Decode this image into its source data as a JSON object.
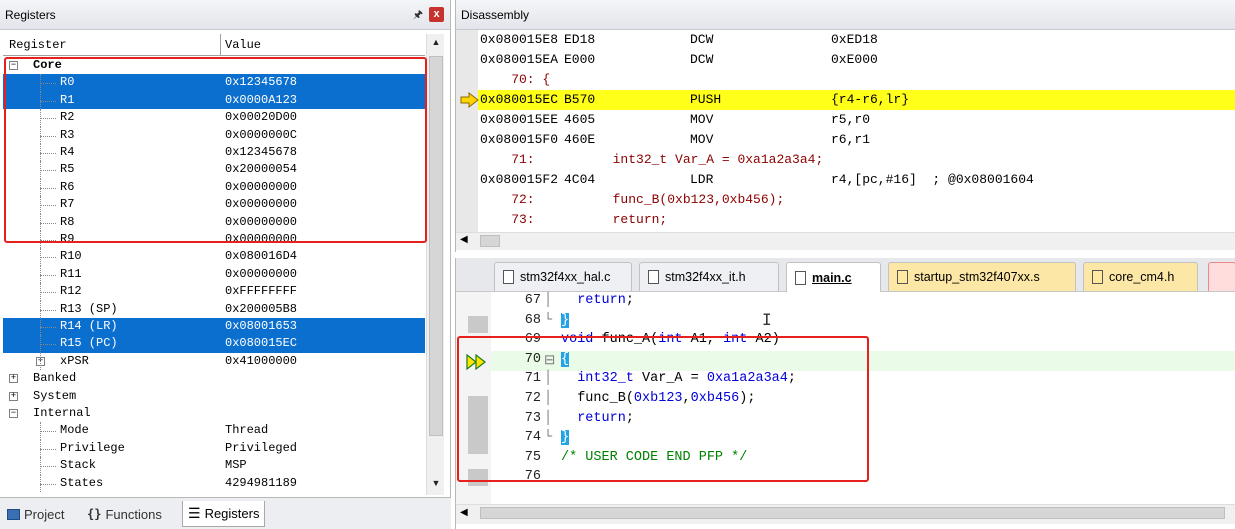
{
  "registers": {
    "title": "Registers",
    "col_register": "Register",
    "col_value": "Value",
    "rows": [
      {
        "name": "Core",
        "value": "",
        "level": 0,
        "expander": "−",
        "selected": false,
        "bold": true
      },
      {
        "name": "R0",
        "value": "0x12345678",
        "level": 1,
        "selected": true
      },
      {
        "name": "R1",
        "value": "0x0000A123",
        "level": 1,
        "selected": true
      },
      {
        "name": "R2",
        "value": "0x00020D00",
        "level": 1,
        "selected": false
      },
      {
        "name": "R3",
        "value": "0x0000000C",
        "level": 1,
        "selected": false
      },
      {
        "name": "R4",
        "value": "0x12345678",
        "level": 1,
        "selected": false
      },
      {
        "name": "R5",
        "value": "0x20000054",
        "level": 1,
        "selected": false
      },
      {
        "name": "R6",
        "value": "0x00000000",
        "level": 1,
        "selected": false
      },
      {
        "name": "R7",
        "value": "0x00000000",
        "level": 1,
        "selected": false
      },
      {
        "name": "R8",
        "value": "0x00000000",
        "level": 1,
        "selected": false
      },
      {
        "name": "R9",
        "value": "0x00000000",
        "level": 1,
        "selected": false
      },
      {
        "name": "R10",
        "value": "0x080016D4",
        "level": 1,
        "selected": false
      },
      {
        "name": "R11",
        "value": "0x00000000",
        "level": 1,
        "selected": false
      },
      {
        "name": "R12",
        "value": "0xFFFFFFFF",
        "level": 1,
        "selected": false
      },
      {
        "name": "R13 (SP)",
        "value": "0x200005B8",
        "level": 1,
        "selected": false
      },
      {
        "name": "R14 (LR)",
        "value": "0x08001653",
        "level": 1,
        "selected": true
      },
      {
        "name": "R15 (PC)",
        "value": "0x080015EC",
        "level": 1,
        "selected": true
      },
      {
        "name": "xPSR",
        "value": "0x41000000",
        "level": 1,
        "expander": "+",
        "selected": false
      },
      {
        "name": "Banked",
        "value": "",
        "level": 0,
        "expander": "+",
        "selected": false
      },
      {
        "name": "System",
        "value": "",
        "level": 0,
        "expander": "+",
        "selected": false
      },
      {
        "name": "Internal",
        "value": "",
        "level": 0,
        "expander": "−",
        "selected": false
      },
      {
        "name": "Mode",
        "value": "Thread",
        "level": 1,
        "selected": false
      },
      {
        "name": "Privilege",
        "value": "Privileged",
        "level": 1,
        "selected": false
      },
      {
        "name": "Stack",
        "value": "MSP",
        "level": 1,
        "selected": false
      },
      {
        "name": "States",
        "value": "4294981189",
        "level": 1,
        "selected": false
      }
    ],
    "tabs": [
      {
        "label": "Project",
        "icon": "project-icon",
        "active": false
      },
      {
        "label": "Functions",
        "icon": "braces-icon",
        "active": false
      },
      {
        "label": "Registers",
        "icon": "registers-icon",
        "active": true
      }
    ],
    "pin_glyph": "ᵖ",
    "close_glyph": "x"
  },
  "disassembly": {
    "title": "Disassembly",
    "lines": [
      {
        "addr": "0x080015E8",
        "op": "ED18",
        "mnem": "DCW",
        "args": "0xED18",
        "current": false
      },
      {
        "addr": "0x080015EA",
        "op": "E000",
        "mnem": "DCW",
        "args": "0xE000",
        "current": false
      },
      {
        "src": "    70: {"
      },
      {
        "addr": "0x080015EC",
        "op": "B570",
        "mnem": "PUSH",
        "args": "{r4-r6,lr}",
        "current": true
      },
      {
        "addr": "0x080015EE",
        "op": "4605",
        "mnem": "MOV",
        "args": "r5,r0",
        "current": false
      },
      {
        "addr": "0x080015F0",
        "op": "460E",
        "mnem": "MOV",
        "args": "r6,r1",
        "current": false
      },
      {
        "src": "    71:          int32_t Var_A = 0xa1a2a3a4;"
      },
      {
        "addr": "0x080015F2",
        "op": "4C04",
        "mnem": "LDR",
        "args": "r4,[pc,#16]  ; @0x08001604",
        "current": false
      },
      {
        "src": "    72:          func_B(0xb123,0xb456);"
      },
      {
        "src": "    73:          return;"
      }
    ]
  },
  "editor": {
    "tabs": [
      {
        "label": "stm32f4xx_hal.c",
        "active": false,
        "yellow": false
      },
      {
        "label": "stm32f4xx_it.h",
        "active": false,
        "yellow": false
      },
      {
        "label": "main.c",
        "active": true,
        "yellow": false
      },
      {
        "label": "startup_stm32f407xx.s",
        "active": false,
        "yellow": true
      },
      {
        "label": "core_cm4.h",
        "active": false,
        "yellow": true
      }
    ],
    "lines": [
      {
        "num": "67",
        "fold": "│",
        "text": "  return;"
      },
      {
        "num": "68",
        "fold": "└",
        "text": "}"
      },
      {
        "num": "69",
        "fold": "",
        "text": "void func_A(int A1, int A2)"
      },
      {
        "num": "70",
        "fold": "⊟",
        "text": "{"
      },
      {
        "num": "71",
        "fold": "│",
        "text": "  int32_t Var_A = 0xa1a2a3a4;"
      },
      {
        "num": "72",
        "fold": "│",
        "text": "  func_B(0xb123,0xb456);"
      },
      {
        "num": "73",
        "fold": "│",
        "text": "  return;"
      },
      {
        "num": "74",
        "fold": "└",
        "text": "}"
      },
      {
        "num": "75",
        "fold": "",
        "text": "/* USER CODE END PFP */"
      },
      {
        "num": "76",
        "fold": "",
        "text": ""
      }
    ]
  }
}
